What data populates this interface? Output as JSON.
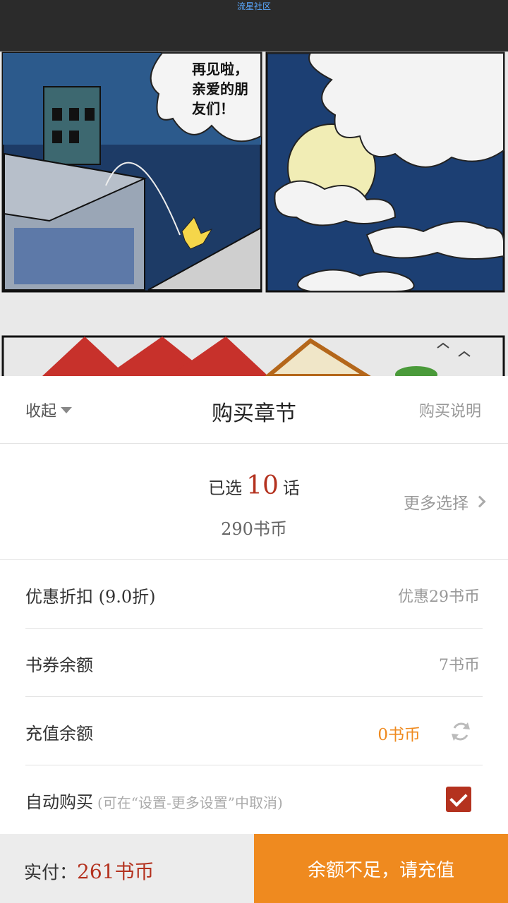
{
  "app": {
    "title": "流星社区"
  },
  "comic": {
    "speech_bubble": "再见啦，\n亲爱的朋\n友们！"
  },
  "sheet": {
    "collapse_label": "收起",
    "title": "购买章节",
    "help_label": "购买说明"
  },
  "selection": {
    "prefix": "已选",
    "count": "10",
    "suffix": "话",
    "price": "290书币",
    "more_label": "更多选择"
  },
  "rows": {
    "discount": {
      "label": "优惠折扣  (9.0折)",
      "value": "优惠29书币"
    },
    "voucher": {
      "label": "书券余额",
      "value": "7书币"
    },
    "recharge_balance": {
      "label": "充值余额",
      "value": "0书币"
    },
    "auto_buy": {
      "label": "自动购买",
      "hint": "(可在“设置-更多设置”中取消)",
      "checked": true
    }
  },
  "footer": {
    "pay_label": "实付：",
    "pay_value": "261书币",
    "recharge_button": "余额不足，请充值"
  },
  "colors": {
    "accent_red": "#b4321f",
    "accent_orange": "#ef8a1f",
    "topbar": "#2b2b2b"
  }
}
